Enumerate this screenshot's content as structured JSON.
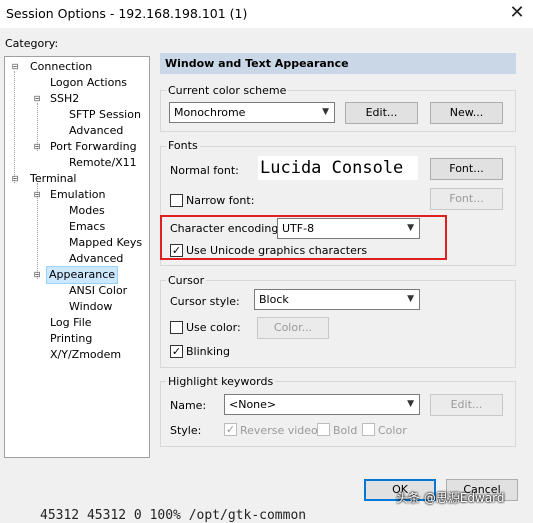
{
  "window": {
    "title": "Session Options - 192.168.198.101 (1)",
    "close_glyph": "✕"
  },
  "category_label": "Category:",
  "tree": [
    {
      "label": "Connection",
      "expander": "⊟"
    },
    {
      "label": "Logon Actions"
    },
    {
      "label": "SSH2",
      "expander": "⊟"
    },
    {
      "label": "SFTP Session"
    },
    {
      "label": "Advanced"
    },
    {
      "label": "Port Forwarding",
      "expander": "⊟"
    },
    {
      "label": "Remote/X11"
    },
    {
      "label": "Terminal",
      "expander": "⊟"
    },
    {
      "label": "Emulation",
      "expander": "⊟"
    },
    {
      "label": "Modes"
    },
    {
      "label": "Emacs"
    },
    {
      "label": "Mapped Keys"
    },
    {
      "label": "Advanced"
    },
    {
      "label": "Appearance",
      "expander": "⊟",
      "selected": true
    },
    {
      "label": "ANSI Color"
    },
    {
      "label": "Window"
    },
    {
      "label": "Log File"
    },
    {
      "label": "Printing"
    },
    {
      "label": "X/Y/Zmodem"
    }
  ],
  "panel_title": "Window and Text Appearance",
  "color_scheme": {
    "group_label": "Current color scheme",
    "value": "Monochrome",
    "edit_button": "Edit...",
    "new_button": "New..."
  },
  "fonts": {
    "group_label": "Fonts",
    "normal_label": "Normal font:",
    "normal_value": "Lucida Console",
    "normal_button": "Font...",
    "narrow_label": "Narrow font:",
    "narrow_checked": false,
    "narrow_button": "Font...",
    "encoding_label": "Character encoding:",
    "encoding_value": "UTF-8",
    "unicode_label": "Use Unicode graphics characters",
    "unicode_checked": true
  },
  "cursor": {
    "group_label": "Cursor",
    "style_label": "Cursor style:",
    "style_value": "Block",
    "use_color_label": "Use color:",
    "use_color_checked": false,
    "color_button": "Color...",
    "blinking_label": "Blinking",
    "blinking_checked": true
  },
  "highlight": {
    "group_label": "Highlight keywords",
    "name_label": "Name:",
    "name_value": "<None>",
    "edit_button": "Edit...",
    "style_label": "Style:",
    "reverse_label": "Reverse video",
    "reverse_checked": true,
    "bold_label": "Bold",
    "bold_checked": false,
    "color_label": "Color",
    "color_checked": false
  },
  "footer": {
    "ok": "OK",
    "cancel": "Cancel"
  },
  "background_text": "45312    45312    0  100% /opt/gtk-common",
  "watermark": "头条 @思源Edward",
  "colors": {
    "accent": "#0078d7",
    "highlight_box": "#e02020",
    "heading_bar": "#c9d7e6",
    "selection": "#cce8ff"
  }
}
